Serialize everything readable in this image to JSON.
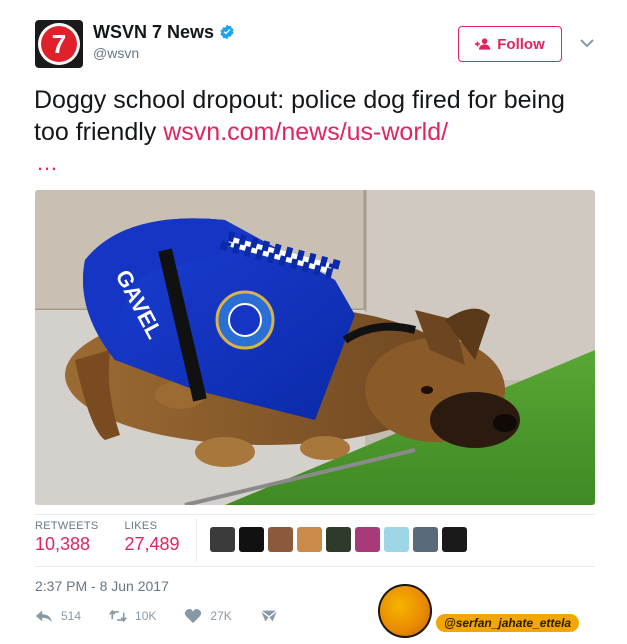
{
  "account": {
    "name": "WSVN 7 News",
    "handle": "@wsvn",
    "avatar_text": "7"
  },
  "header": {
    "follow_label": "Follow"
  },
  "tweet": {
    "text": "Doggy school dropout: police dog fired for being too friendly",
    "link": "wsvn.com/news/us-world/",
    "ellipsis": "…"
  },
  "media": {
    "vest_text": "GAVEL",
    "badge_text": "QUEENSLAND POLICE"
  },
  "stats": {
    "retweets_label": "RETWEETS",
    "retweets_value": "10,388",
    "likes_label": "LIKES",
    "likes_value": "27,489"
  },
  "likers": [
    "user-1",
    "user-2",
    "user-3",
    "user-4",
    "user-5",
    "user-6",
    "user-7",
    "user-8",
    "user-9"
  ],
  "timestamp": "2:37 PM - 8 Jun 2017",
  "actions": {
    "reply_count": "514",
    "retweet_count": "10K",
    "like_count": "27K"
  },
  "watermark": {
    "text": "@serfan_jahate_ettela"
  },
  "colors": {
    "accent": "#e0245e",
    "verified": "#1da1f2",
    "muted": "#657786"
  }
}
